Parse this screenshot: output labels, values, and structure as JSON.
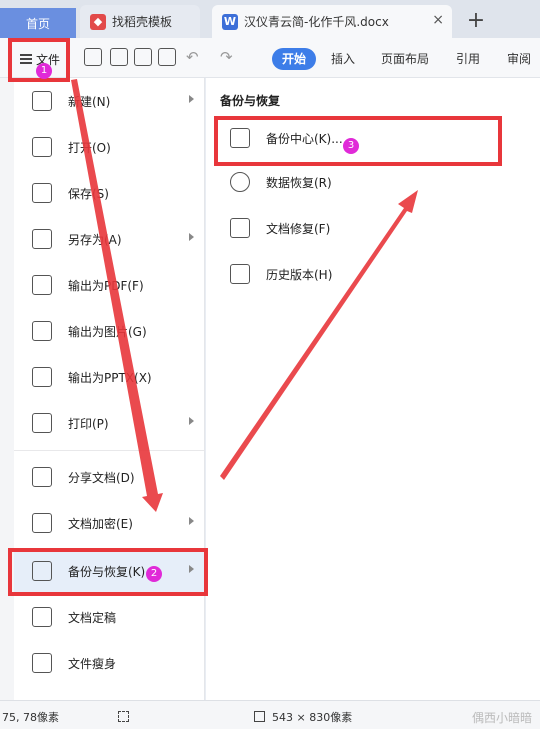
{
  "tabs": {
    "home": "首页",
    "template": "找稻壳模板",
    "document": "汉仪青云简-化作千风.docx",
    "close": "×",
    "add": "+"
  },
  "toolbar": {
    "file": "文件",
    "ribbon_tabs": [
      "开始",
      "插入",
      "页面布局",
      "引用",
      "审阅"
    ]
  },
  "file_menu": {
    "items": [
      {
        "label": "新建(N)",
        "icon": "new-icon",
        "submenu": true
      },
      {
        "label": "打开(O)",
        "icon": "folder-icon",
        "submenu": false
      },
      {
        "label": "保存(S)",
        "icon": "save-icon",
        "submenu": false
      },
      {
        "label": "另存为(A)",
        "icon": "save-as-icon",
        "submenu": true
      },
      {
        "label": "输出为PDF(F)",
        "icon": "pdf-icon",
        "submenu": false
      },
      {
        "label": "输出为图片(G)",
        "icon": "image-icon",
        "submenu": false
      },
      {
        "label": "输出为PPTX(X)",
        "icon": "pptx-icon",
        "submenu": false
      },
      {
        "label": "打印(P)",
        "icon": "print-icon",
        "submenu": true
      },
      {
        "label": "分享文档(D)",
        "icon": "share-icon",
        "submenu": false
      },
      {
        "label": "文档加密(E)",
        "icon": "encrypt-icon",
        "submenu": true
      },
      {
        "label": "备份与恢复(K)",
        "icon": "backup-icon",
        "submenu": true
      },
      {
        "label": "文档定稿",
        "icon": "finalize-icon",
        "submenu": false
      },
      {
        "label": "文件瘦身",
        "icon": "slim-icon",
        "submenu": false
      }
    ]
  },
  "backup_submenu": {
    "title": "备份与恢复",
    "items": [
      {
        "label": "备份中心(K)...",
        "icon": "backup-center-icon"
      },
      {
        "label": "数据恢复(R)",
        "icon": "data-recovery-icon"
      },
      {
        "label": "文档修复(F)",
        "icon": "doc-repair-icon"
      },
      {
        "label": "历史版本(H)",
        "icon": "history-icon"
      }
    ]
  },
  "status": {
    "coords": "75, 78像素",
    "size": "543 × 830像素"
  },
  "watermark": "偶西小暗暗",
  "badges": [
    "1",
    "2",
    "3"
  ],
  "colors": {
    "annotation": "#e8363b",
    "badge": "#e02ad8",
    "accent": "#3d7de8"
  }
}
